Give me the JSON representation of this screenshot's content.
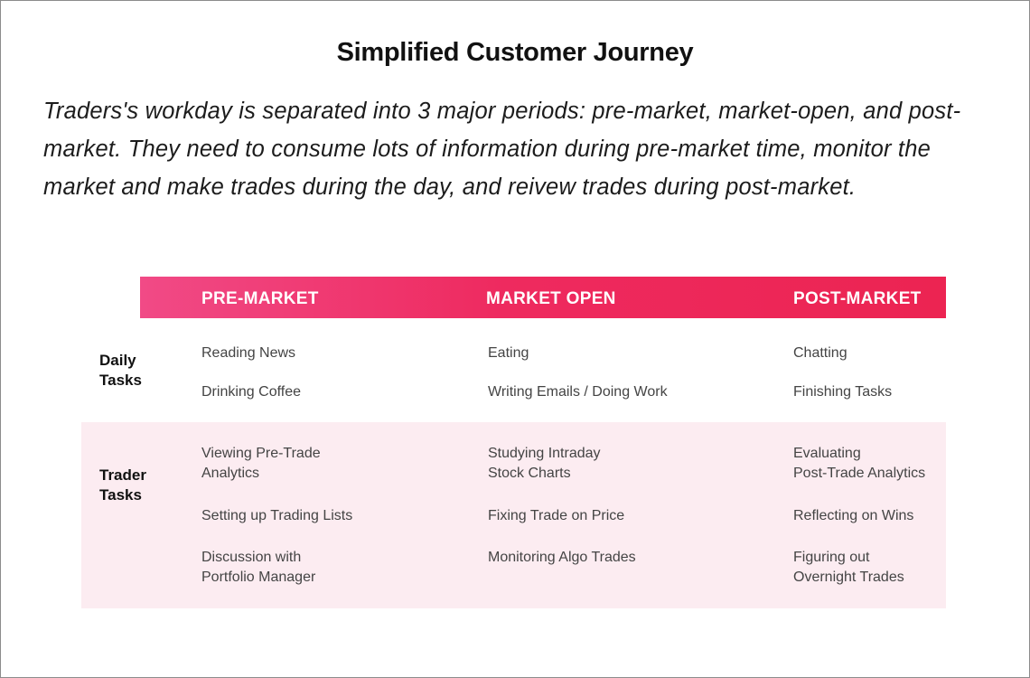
{
  "title": "Simplified Customer Journey",
  "description": "Traders's workday is separated into 3 major periods: pre-market, market-open, and post-market. They need to consume lots of information during pre-market time, monitor the market and make trades during the day, and reivew trades during post-market.",
  "header_color": "#ee2a5f",
  "band_color": "#fcecf1",
  "columns": [
    "PRE-MARKET",
    "MARKET OPEN",
    "POST-MARKET"
  ],
  "rows": [
    {
      "label": "Daily\nTasks",
      "cells": [
        [
          "Reading News",
          "Eating",
          "Chatting"
        ],
        [
          "Drinking Coffee",
          "Writing Emails / Doing Work",
          "Finishing Tasks"
        ]
      ]
    },
    {
      "label": "Trader\nTasks",
      "cells": [
        [
          "Viewing Pre-Trade\nAnalytics",
          "Studying Intraday\nStock Charts",
          "Evaluating\nPost-Trade Analytics"
        ],
        [
          "Setting up Trading Lists",
          "Fixing Trade on Price",
          "Reflecting on Wins"
        ],
        [
          "Discussion with\nPortfolio Manager",
          "Monitoring Algo Trades",
          "Figuring out\nOvernight Trades"
        ]
      ]
    }
  ]
}
